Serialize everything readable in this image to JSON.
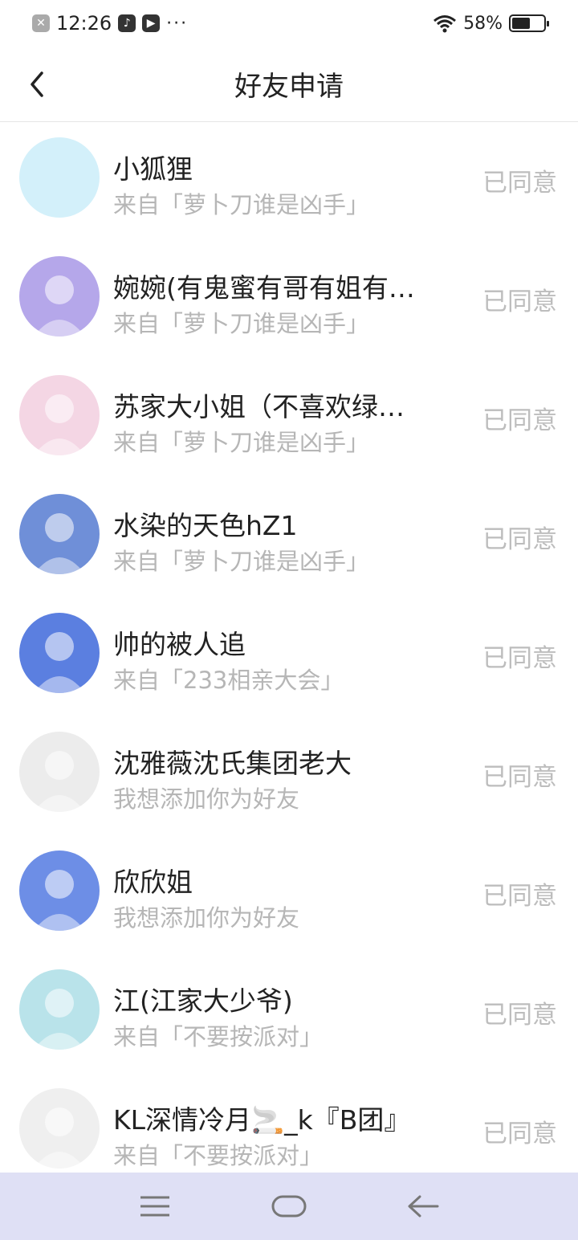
{
  "status_bar": {
    "time": "12:26",
    "dots": "···",
    "battery_percent": "58%",
    "battery_level": 0.58
  },
  "header": {
    "title": "好友申请",
    "back_icon": "chevron-left-icon"
  },
  "requests": [
    {
      "name": "小狐狸",
      "source": "来自「萝卜刀谁是凶手」",
      "status": "已同意",
      "avatar_color": "#d3f0fa"
    },
    {
      "name": "婉婉(有鬼蜜有哥有姐有…",
      "source": "来自「萝卜刀谁是凶手」",
      "status": "已同意",
      "avatar_color": "#b5a7ea"
    },
    {
      "name": "苏家大小姐（不喜欢绿…",
      "source": "来自「萝卜刀谁是凶手」",
      "status": "已同意",
      "avatar_color": "#f4d6e4"
    },
    {
      "name": "水染的天色hZ1",
      "source": "来自「萝卜刀谁是凶手」",
      "status": "已同意",
      "avatar_color": "#6f8fd8"
    },
    {
      "name": "帅的被人追",
      "source": "来自「233相亲大会」",
      "status": "已同意",
      "avatar_color": "#5b7fe0"
    },
    {
      "name": "沈雅薇沈氏集团老大",
      "source": "我想添加你为好友",
      "status": "已同意",
      "avatar_color": "#ececec"
    },
    {
      "name": "欣欣姐",
      "source": "我想添加你为好友",
      "status": "已同意",
      "avatar_color": "#6d8ee6"
    },
    {
      "name": "江(江家大少爷)",
      "source": "来自「不要按派对」",
      "status": "已同意",
      "avatar_color": "#b9e3ea"
    },
    {
      "name": "KL深情冷月🚬_k『B团』",
      "source": "来自「不要按派对」",
      "status": "已同意",
      "avatar_color": "#efefef"
    }
  ],
  "nav_bar": {
    "menu_icon": "menu-icon",
    "home_icon": "home-icon",
    "back_icon": "back-arrow-icon",
    "background": "#dfe0f5"
  }
}
